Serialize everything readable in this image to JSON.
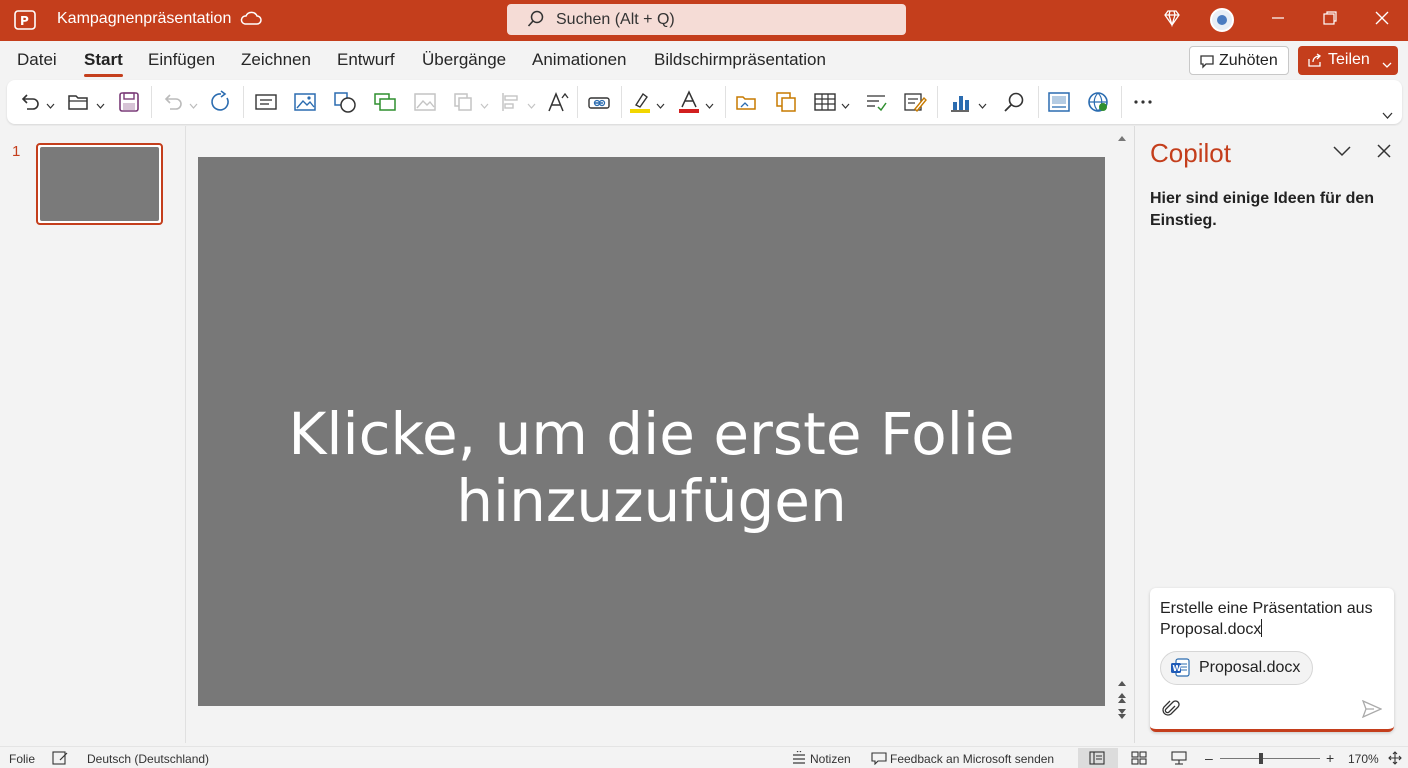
{
  "titlebar": {
    "doc_title": "Kampagnenpräsentation",
    "search_placeholder": "Suchen (Alt + Q)",
    "accent_color": "#c43e1c"
  },
  "menu": {
    "tabs": [
      "Datei",
      "Start",
      "Einfügen",
      "Zeichnen",
      "Entwurf",
      "Übergänge",
      "Animationen",
      "Bildschirmpräsentation"
    ],
    "active_tab": "Start",
    "listen_label": "Zuhöten",
    "share_label": "Teilen"
  },
  "ribbon": {
    "icons": [
      "undo-icon",
      "open-folder-icon",
      "save-icon",
      "undo-disabled-icon",
      "redo-icon",
      "text-box-icon",
      "picture-icon",
      "shapes-icon",
      "new-slide-icon",
      "image-disabled-icon",
      "arrange-disabled-icon",
      "align-disabled-icon",
      "font-size-icon",
      "link-icon",
      "highlight-color-icon",
      "font-color-icon",
      "insert-picture-icon",
      "object-icon",
      "table-icon",
      "check-icon",
      "edit-icon",
      "chart-icon",
      "search-icon",
      "designer-icon",
      "globe-icon",
      "more-icon"
    ]
  },
  "slides": {
    "count_label": "1",
    "placeholder_text": "Klicke, um die erste Folie hinzuzufügen"
  },
  "copilot": {
    "title": "Copilot",
    "intro": "Hier sind einige Ideen für den Einstieg.",
    "prompt": "Erstelle eine Präsentation aus Proposal.docx",
    "attachment": "Proposal.docx"
  },
  "statusbar": {
    "slide_label": "Folie",
    "language": "Deutsch (Deutschland)",
    "notes_label": "Notizen",
    "feedback_label": "Feedback an Microsoft senden",
    "zoom": "170%"
  }
}
